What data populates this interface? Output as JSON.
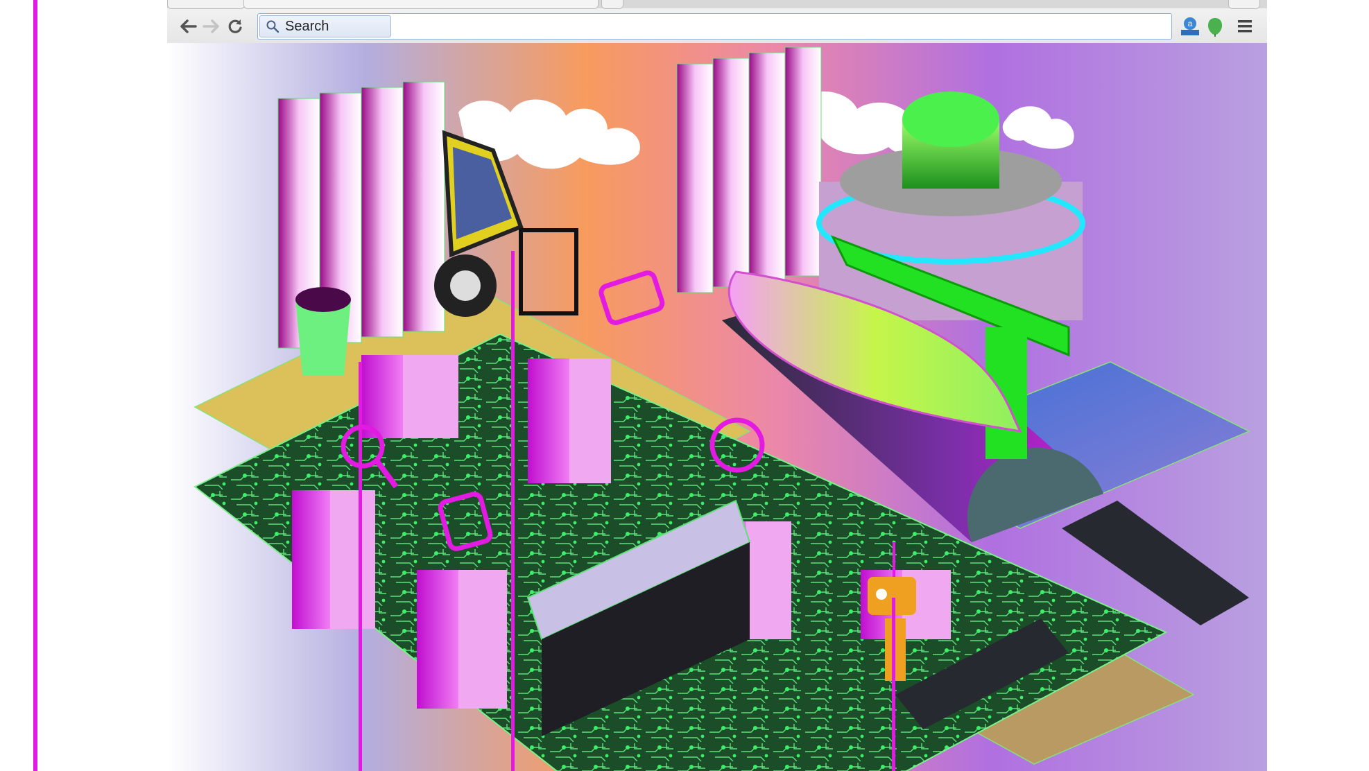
{
  "toolbar": {
    "back_icon": "arrow-left-icon",
    "forward_icon": "arrow-right-icon",
    "reload_icon": "reload-icon",
    "menu_icon": "hamburger-menu-icon"
  },
  "search": {
    "label": "Search",
    "icon": "magnifier-icon"
  },
  "extensions": [
    {
      "name": "extension-a-icon",
      "glyph": "a"
    },
    {
      "name": "evernote-icon"
    }
  ],
  "colors": {
    "magenta_accent": "#e21ae2",
    "circuit_green": "#1f5a2e",
    "pink_block": "#f0a8f0",
    "sky_orange": "#f79b5e",
    "sky_purple": "#b070e0"
  }
}
